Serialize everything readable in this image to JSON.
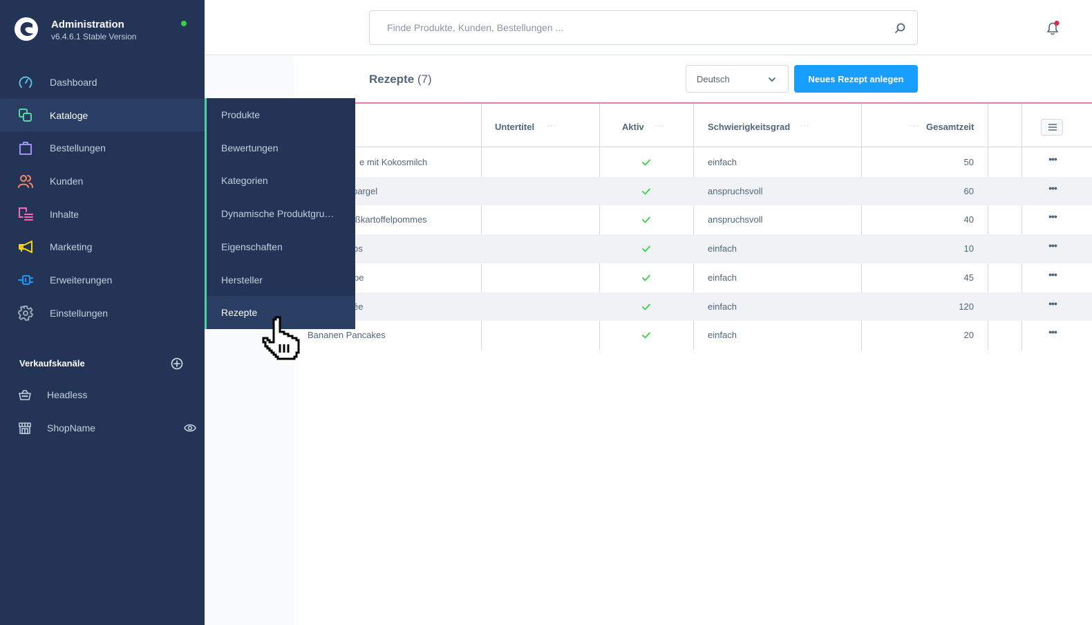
{
  "brand": {
    "title": "Administration",
    "version": "v6.4.6.1 Stable Version",
    "status_color": "#37d046"
  },
  "sidebar": {
    "items": [
      {
        "label": "Dashboard",
        "icon": "dashboard-icon",
        "color": "#5bc0de"
      },
      {
        "label": "Kataloge",
        "icon": "catalog-icon",
        "color": "#57d9a3",
        "active": true
      },
      {
        "label": "Bestellungen",
        "icon": "shopping-bag-icon",
        "color": "#a092f0"
      },
      {
        "label": "Kunden",
        "icon": "users-icon",
        "color": "#f88962"
      },
      {
        "label": "Inhalte",
        "icon": "content-icon",
        "color": "#ff68b4"
      },
      {
        "label": "Marketing",
        "icon": "megaphone-icon",
        "color": "#ffd700"
      },
      {
        "label": "Erweiterungen",
        "icon": "plug-icon",
        "color": "#189eff"
      },
      {
        "label": "Einstellungen",
        "icon": "gear-icon",
        "color": "#9aa8b5"
      }
    ],
    "sales_channels": {
      "title": "Verkaufskanäle",
      "items": [
        {
          "label": "Headless",
          "icon": "basket-icon"
        },
        {
          "label": "ShopName",
          "icon": "storefront-icon"
        }
      ]
    }
  },
  "flyout": {
    "items": [
      {
        "label": "Produkte"
      },
      {
        "label": "Bewertungen"
      },
      {
        "label": "Kategorien"
      },
      {
        "label": "Dynamische Produktgru…"
      },
      {
        "label": "Eigenschaften"
      },
      {
        "label": "Hersteller"
      },
      {
        "label": "Rezepte",
        "active": true
      }
    ]
  },
  "search": {
    "placeholder": "Finde Produkte, Kunden, Bestellungen ..."
  },
  "notifications": {
    "has_unread": true,
    "badge_color": "#de294c"
  },
  "page": {
    "title": "Rezepte",
    "count": "(7)",
    "language": "Deutsch",
    "create_button": "Neues Rezept anlegen",
    "accent_color": "#189eff"
  },
  "table": {
    "columns": [
      {
        "label": ""
      },
      {
        "label": "Untertitel"
      },
      {
        "label": "Aktiv"
      },
      {
        "label": "Schwierigkeitsgrad"
      },
      {
        "label": "Gesamtzeit"
      }
    ],
    "rows": [
      {
        "name": "e mit Kokosmilch",
        "subtitle": "",
        "active": true,
        "difficulty": "einfach",
        "time": "50"
      },
      {
        "name": "pargel",
        "subtitle": "",
        "active": true,
        "difficulty": "anspruchsvoll",
        "time": "60"
      },
      {
        "name": "ißkartoffelpommes",
        "subtitle": "",
        "active": true,
        "difficulty": "anspruchsvoll",
        "time": "40"
      },
      {
        "name": "os",
        "subtitle": "",
        "active": true,
        "difficulty": "einfach",
        "time": "10"
      },
      {
        "name": "pe",
        "subtitle": "",
        "active": true,
        "difficulty": "einfach",
        "time": "45"
      },
      {
        "name": "ée",
        "subtitle": "",
        "active": true,
        "difficulty": "einfach",
        "time": "120"
      },
      {
        "name": "Bananen Pancakes",
        "subtitle": "",
        "active": true,
        "difficulty": "einfach",
        "time": "20"
      }
    ]
  }
}
